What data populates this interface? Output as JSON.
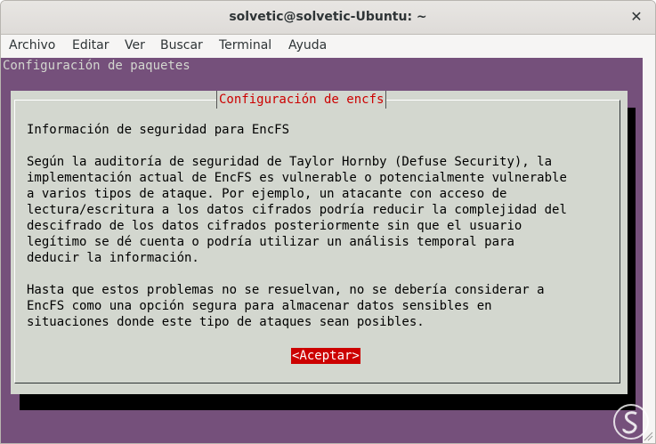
{
  "window": {
    "title": "solvetic@solvetic-Ubuntu: ~",
    "close_glyph": "✕"
  },
  "menu": {
    "items": [
      "Archivo",
      "Editar",
      "Ver",
      "Buscar",
      "Terminal",
      "Ayuda"
    ]
  },
  "terminal": {
    "header": "Configuración de paquetes",
    "dialog": {
      "title": "Configuración de encfs",
      "text": "Información de seguridad para EncFS\n\nSegún la auditoría de seguridad de Taylor Hornby (Defuse Security), la\nimplementación actual de EncFS es vulnerable o potencialmente vulnerable\na varios tipos de ataque. Por ejemplo, un atacante con acceso de\nlectura/escritura a los datos cifrados podría reducir la complejidad del\ndescifrado de los datos cifrados posteriormente sin que el usuario\nlegítimo se dé cuenta o podría utilizar un análisis temporal para\ndeducir la información.\n\nHasta que estos problemas no se resuelvan, no se debería considerar a\nEncFS como una opción segura para almacenar datos sensibles en\nsituaciones donde este tipo de ataques sean posibles.",
      "accept_label": "<Aceptar>"
    }
  },
  "colors": {
    "terminal_bg": "#75507b",
    "dialog_bg": "#d3d7cf",
    "accent_red": "#cc0000"
  },
  "icons": {
    "close": "close-icon",
    "watermark": "solvetic-logo-icon"
  }
}
